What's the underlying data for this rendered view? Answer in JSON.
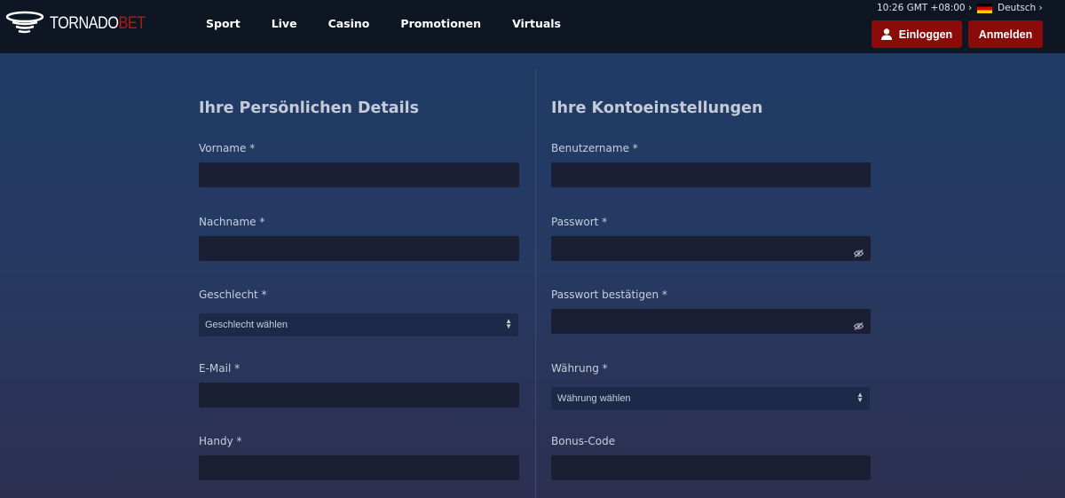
{
  "brand": {
    "part1": "TORNADO",
    "part2": "BET"
  },
  "nav": [
    "Sport",
    "Live",
    "Casino",
    "Promotionen",
    "Virtuals"
  ],
  "header": {
    "time": "10:26  GMT +08:00 ›",
    "language": "Deutsch ›",
    "login": "Einloggen",
    "register": "Anmelden"
  },
  "colors": {
    "accent": "#8b0a0a",
    "header_bg": "#0e1623",
    "brand_red": "#b3161b"
  },
  "left": {
    "title": "Ihre Persönlichen Details",
    "fields": [
      {
        "label": "Vorname *",
        "type": "text"
      },
      {
        "label": "Nachname *",
        "type": "text"
      },
      {
        "label": "Geschlecht *",
        "type": "select",
        "value": "Geschlecht wählen"
      },
      {
        "label": "E-Mail *",
        "type": "text"
      },
      {
        "label": "Handy *",
        "type": "text"
      }
    ]
  },
  "right": {
    "title": "Ihre Kontoeinstellungen",
    "fields": [
      {
        "label": "Benutzername *",
        "type": "text"
      },
      {
        "label": "Passwort *",
        "type": "password"
      },
      {
        "label": "Passwort bestätigen *",
        "type": "password"
      },
      {
        "label": "Währung *",
        "type": "select",
        "value": "Währung wählen"
      },
      {
        "label": "Bonus-Code",
        "type": "text"
      }
    ]
  }
}
